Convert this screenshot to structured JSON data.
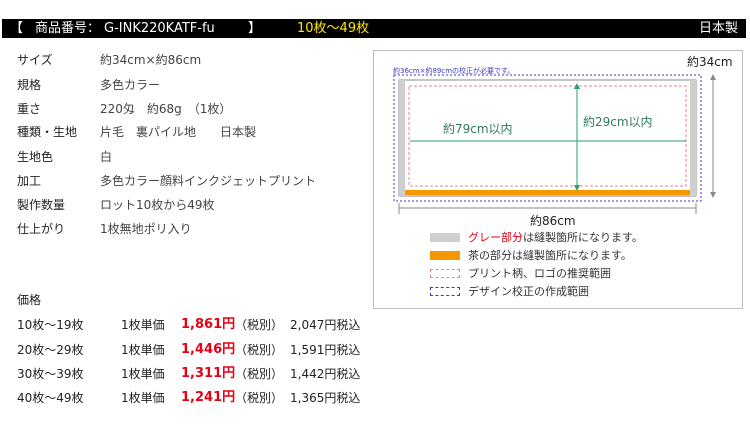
{
  "header": {
    "bracket_open": "【",
    "code_label": "商品番号：",
    "code": "G-INK220KATF-fu",
    "bracket_close": "】",
    "quantity": "10枚〜49枚",
    "made_in": "日本製"
  },
  "specs": [
    {
      "label": "サイズ",
      "value": "約34cm×約86cm"
    },
    {
      "label": "規格",
      "value": "多色カラー"
    },
    {
      "label": "重さ",
      "value": "220匁　約68g　（1枚）"
    },
    {
      "label": "種類・生地",
      "value": "片毛　裏パイル地　　日本製"
    },
    {
      "label": "生地色",
      "value": "白"
    },
    {
      "label": "加工",
      "value": "多色カラー顔料インクジェットプリント"
    },
    {
      "label": "製作数量",
      "value": "ロット10枚から49枚"
    },
    {
      "label": "仕上がり",
      "value": " 1枚無地ポリ入り"
    }
  ],
  "price": {
    "heading": "価格",
    "rows": [
      {
        "range": "10枚〜19枚",
        "unit": "1枚単価",
        "price": "1,861円",
        "tax_ex": "（税別）",
        "tax_in": "2,047円税込"
      },
      {
        "range": "20枚〜29枚",
        "unit": "1枚単価",
        "price": "1,446円",
        "tax_ex": "（税別）",
        "tax_in": "1,591円税込"
      },
      {
        "range": "30枚〜39枚",
        "unit": "1枚単価",
        "price": "1,311円",
        "tax_ex": "（税別）",
        "tax_in": "1,442円税込"
      },
      {
        "range": "40枚〜49枚",
        "unit": "1枚単価",
        "price": "1,241円",
        "tax_ex": "（税別）",
        "tax_in": "1,365円税込"
      }
    ]
  },
  "diagram": {
    "height_label": "約34cm",
    "width_label": "約86cm",
    "proof_note": "約36cm×約89cmの校正が必要です。",
    "inner_width_label": "約79cm以内",
    "inner_height_label": "約29cm以内",
    "colors": {
      "gray_part": "#cfcfcf",
      "brown_part": "#f39800",
      "print_area": "#f08080",
      "proof_area": "#3a3acc",
      "guide_line": "#2e9e6e"
    }
  },
  "legend": {
    "gray_part_label": "グレー部分",
    "gray_part_suffix": "は縫製箇所になります。",
    "brown_part_label": "茶の部分は縫製箇所になります。",
    "print_area_label": "プリント柄、ロゴの推奨範囲",
    "proof_area_label": "デザイン校正の作成範囲"
  }
}
